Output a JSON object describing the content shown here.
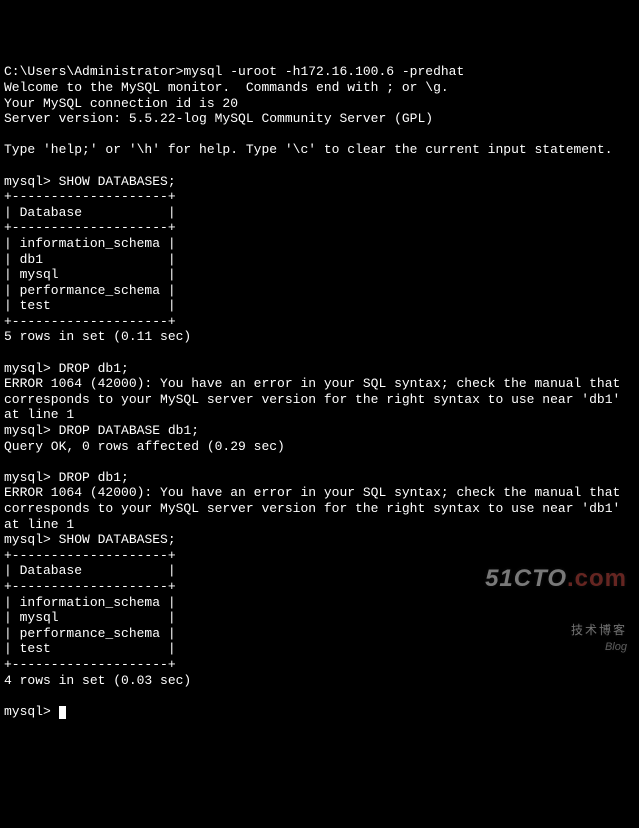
{
  "path_prompt": "C:\\Users\\Administrator>",
  "connect_cmd": "mysql -uroot -h172.16.100.6 -predhat",
  "welcome": "Welcome to the MySQL monitor.  Commands end with ; or \\g.",
  "conn_id": "Your MySQL connection id is 20",
  "server_version": "Server version: 5.5.22-log MySQL Community Server (GPL)",
  "help_line": "Type 'help;' or '\\h' for help. Type '\\c' to clear the current input statement.",
  "prompt": "mysql>",
  "cmd_show1": "SHOW DATABASES;",
  "table1": {
    "border_top": "+--------------------+",
    "header": "| Database           |",
    "border_mid": "+--------------------+",
    "rows": [
      "| information_schema |",
      "| db1                |",
      "| mysql              |",
      "| performance_schema |",
      "| test               |"
    ],
    "border_bot": "+--------------------+",
    "summary": "5 rows in set (0.11 sec)"
  },
  "cmd_drop1": "DROP db1;",
  "error1_l1": "ERROR 1064 (42000): You have an error in your SQL syntax; check the manual that",
  "error1_l2": "corresponds to your MySQL server version for the right syntax to use near 'db1'",
  "error1_l3": "at line 1",
  "cmd_drop2": "DROP DATABASE db1;",
  "drop_ok": "Query OK, 0 rows affected (0.29 sec)",
  "cmd_drop3": "DROP db1;",
  "error2_l1": "ERROR 1064 (42000): You have an error in your SQL syntax; check the manual that",
  "error2_l2": "corresponds to your MySQL server version for the right syntax to use near 'db1'",
  "error2_l3": "at line 1",
  "cmd_show2": "SHOW DATABASES;",
  "table2": {
    "border_top": "+--------------------+",
    "header": "| Database           |",
    "border_mid": "+--------------------+",
    "rows": [
      "| information_schema |",
      "| mysql              |",
      "| performance_schema |",
      "| test               |"
    ],
    "border_bot": "+--------------------+",
    "summary": "4 rows in set (0.03 sec)"
  },
  "watermark": {
    "brand_main": "51CTO",
    "brand_suffix": ".com",
    "sub": "技术博客",
    "blog": "Blog"
  }
}
